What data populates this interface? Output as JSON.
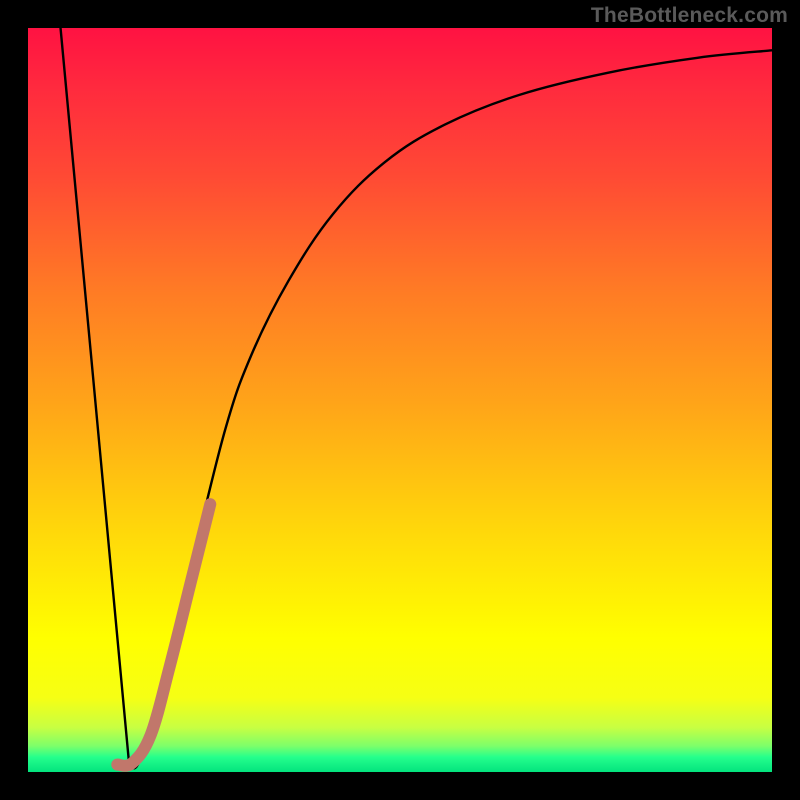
{
  "watermark": "TheBottleneck.com",
  "colors": {
    "frame": "#000000",
    "curve_black": "#000000",
    "highlight_stroke": "#c1776b",
    "gradient_top": "#ff1242",
    "gradient_bottom": "#03e37e"
  },
  "chart_data": {
    "type": "line",
    "title": "",
    "xlabel": "",
    "ylabel": "",
    "xlim": [
      0,
      100
    ],
    "ylim": [
      0,
      100
    ],
    "grid": false,
    "annotations": [],
    "series": [
      {
        "name": "black-v-curve",
        "stroke": "curve_black",
        "points": [
          {
            "x": 4.0,
            "y": 104.0
          },
          {
            "x": 13.6,
            "y": 1.0
          },
          {
            "x": 15.0,
            "y": 1.5
          },
          {
            "x": 18.0,
            "y": 12.0
          },
          {
            "x": 22.0,
            "y": 28.0
          },
          {
            "x": 26.5,
            "y": 46.0
          },
          {
            "x": 30.0,
            "y": 56.0
          },
          {
            "x": 35.0,
            "y": 66.0
          },
          {
            "x": 41.0,
            "y": 75.0
          },
          {
            "x": 48.0,
            "y": 82.0
          },
          {
            "x": 56.0,
            "y": 87.0
          },
          {
            "x": 66.0,
            "y": 91.0
          },
          {
            "x": 78.0,
            "y": 94.0
          },
          {
            "x": 90.0,
            "y": 96.0
          },
          {
            "x": 100.0,
            "y": 97.0
          }
        ]
      },
      {
        "name": "highlight-segment",
        "stroke": "highlight_stroke",
        "points": [
          {
            "x": 12.0,
            "y": 1.0
          },
          {
            "x": 14.0,
            "y": 1.2
          },
          {
            "x": 16.5,
            "y": 5.0
          },
          {
            "x": 19.0,
            "y": 14.0
          },
          {
            "x": 22.0,
            "y": 26.0
          },
          {
            "x": 24.5,
            "y": 36.0
          }
        ]
      }
    ]
  }
}
